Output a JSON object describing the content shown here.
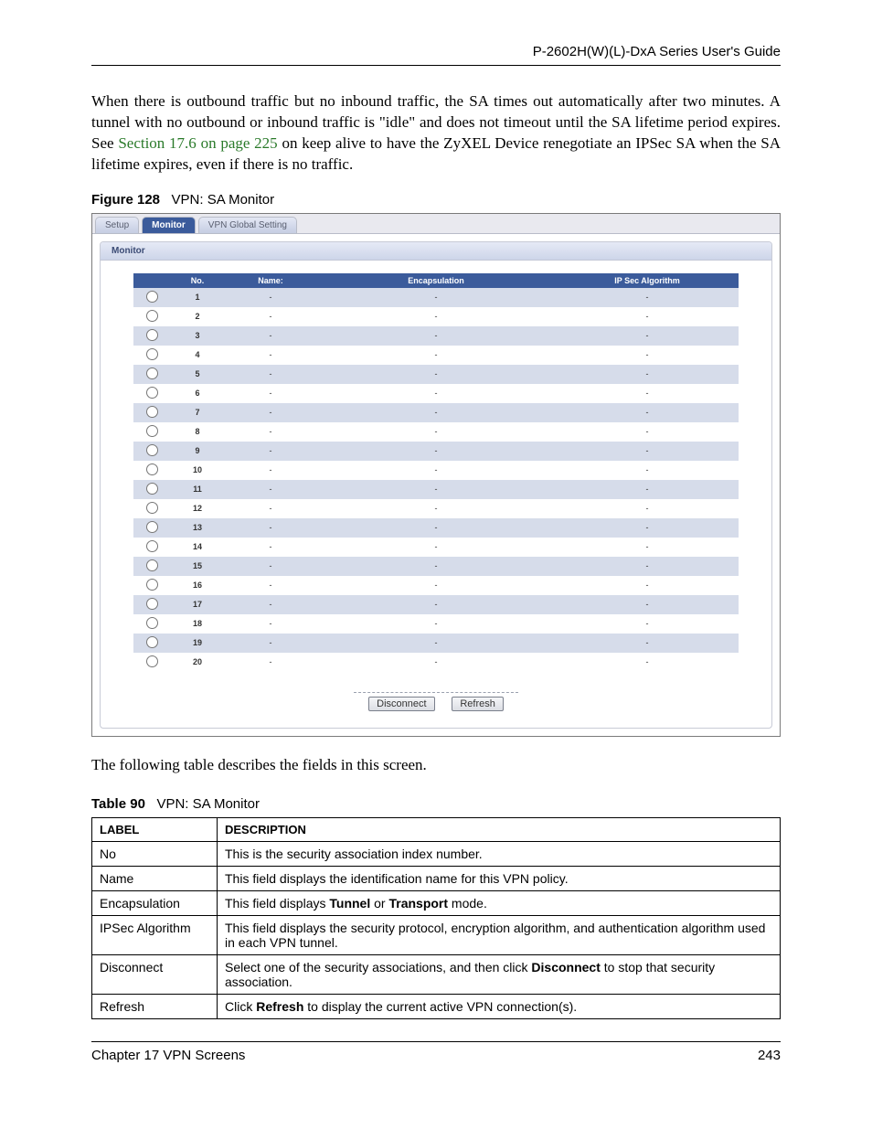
{
  "header": {
    "title": "P-2602H(W)(L)-DxA Series User's Guide"
  },
  "para1": {
    "pre": "When there is outbound traffic but no inbound traffic, the SA times out automatically after two minutes. A tunnel with no outbound or inbound traffic is \"idle\" and does not timeout until the SA lifetime period expires. See",
    "link": "Section 17.6 on page 225",
    "post": "on keep alive to have the ZyXEL Device renegotiate an IPSec SA when the SA lifetime expires, even if there is no traffic."
  },
  "figure": {
    "label": "Figure 128",
    "caption": "VPN: SA Monitor"
  },
  "screenshot": {
    "tabs": [
      "Setup",
      "Monitor",
      "VPN Global Setting"
    ],
    "active_tab": "Monitor",
    "sub_header": "Monitor",
    "columns": {
      "no": "No.",
      "name": "Name:",
      "encap": "Encapsulation",
      "algo": "IP Sec Algorithm"
    },
    "rows": [
      {
        "no": "1",
        "name": "-",
        "encap": "-",
        "algo": "-"
      },
      {
        "no": "2",
        "name": "-",
        "encap": "-",
        "algo": "-"
      },
      {
        "no": "3",
        "name": "-",
        "encap": "-",
        "algo": "-"
      },
      {
        "no": "4",
        "name": "-",
        "encap": "-",
        "algo": "-"
      },
      {
        "no": "5",
        "name": "-",
        "encap": "-",
        "algo": "-"
      },
      {
        "no": "6",
        "name": "-",
        "encap": "-",
        "algo": "-"
      },
      {
        "no": "7",
        "name": "-",
        "encap": "-",
        "algo": "-"
      },
      {
        "no": "8",
        "name": "-",
        "encap": "-",
        "algo": "-"
      },
      {
        "no": "9",
        "name": "-",
        "encap": "-",
        "algo": "-"
      },
      {
        "no": "10",
        "name": "-",
        "encap": "-",
        "algo": "-"
      },
      {
        "no": "11",
        "name": "-",
        "encap": "-",
        "algo": "-"
      },
      {
        "no": "12",
        "name": "-",
        "encap": "-",
        "algo": "-"
      },
      {
        "no": "13",
        "name": "-",
        "encap": "-",
        "algo": "-"
      },
      {
        "no": "14",
        "name": "-",
        "encap": "-",
        "algo": "-"
      },
      {
        "no": "15",
        "name": "-",
        "encap": "-",
        "algo": "-"
      },
      {
        "no": "16",
        "name": "-",
        "encap": "-",
        "algo": "-"
      },
      {
        "no": "17",
        "name": "-",
        "encap": "-",
        "algo": "-"
      },
      {
        "no": "18",
        "name": "-",
        "encap": "-",
        "algo": "-"
      },
      {
        "no": "19",
        "name": "-",
        "encap": "-",
        "algo": "-"
      },
      {
        "no": "20",
        "name": "-",
        "encap": "-",
        "algo": "-"
      }
    ],
    "buttons": {
      "disconnect": "Disconnect",
      "refresh": "Refresh"
    }
  },
  "para2": "The following table describes the fields in this screen.",
  "table": {
    "label": "Table 90",
    "caption": "VPN: SA Monitor",
    "head": {
      "label": "LABEL",
      "desc": "DESCRIPTION"
    },
    "rows": [
      {
        "label": "No",
        "desc": "This is the security association index number."
      },
      {
        "label": "Name",
        "desc": "This field displays the identification name for this VPN policy."
      },
      {
        "label": "Encapsulation",
        "desc_html": "This field displays <b>Tunnel</b> or <b>Transport</b> mode."
      },
      {
        "label": "IPSec Algorithm",
        "desc": "This field displays the security protocol, encryption algorithm, and authentication algorithm used in each VPN tunnel."
      },
      {
        "label": "Disconnect",
        "desc_html": "Select one of the security associations, and then click <b>Disconnect</b> to stop that security association."
      },
      {
        "label": "Refresh",
        "desc_html": "Click <b>Refresh</b> to display the current active VPN connection(s)."
      }
    ]
  },
  "footer": {
    "left": "Chapter 17 VPN Screens",
    "right": "243"
  }
}
